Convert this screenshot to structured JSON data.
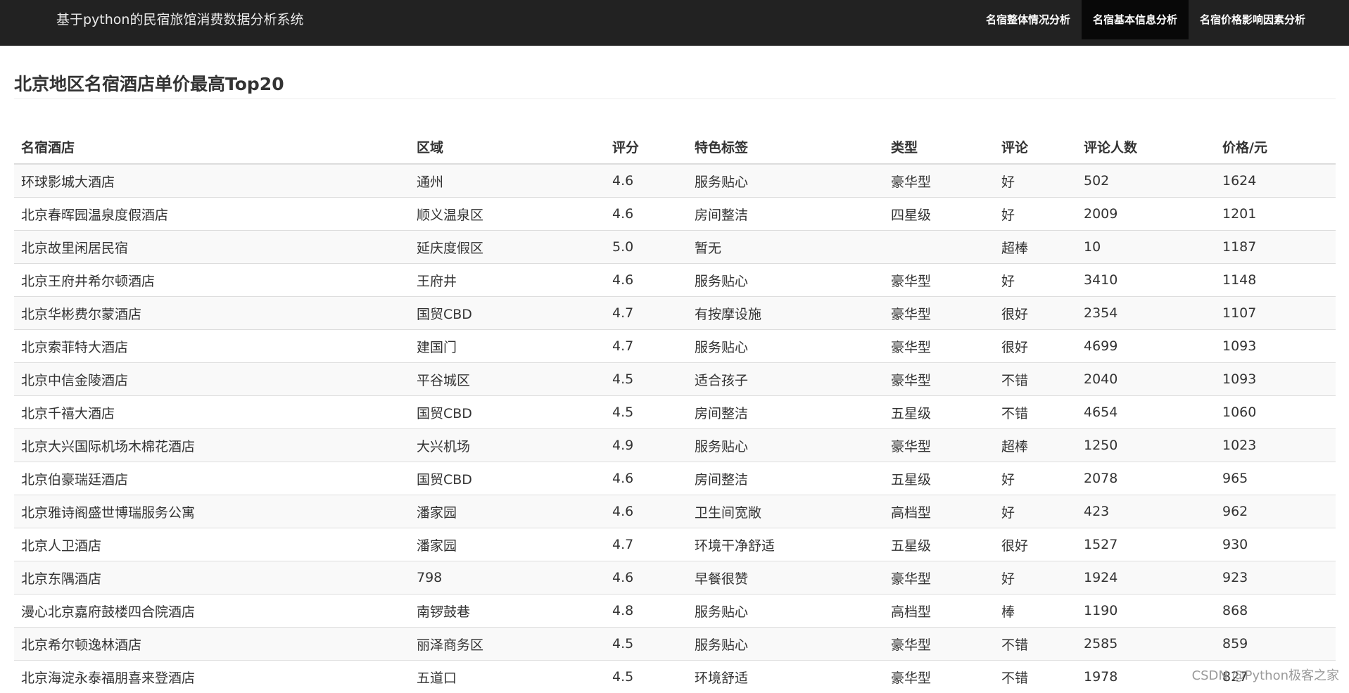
{
  "navbar": {
    "brand": "基于python的民宿旅馆消费数据分析系统",
    "items": [
      {
        "label": "名宿整体情况分析",
        "active": false
      },
      {
        "label": "名宿基本信息分析",
        "active": true
      },
      {
        "label": "名宿价格影响因素分析",
        "active": false
      }
    ]
  },
  "page": {
    "title": "北京地区名宿酒店单价最高Top20"
  },
  "table": {
    "headers": [
      "名宿酒店",
      "区域",
      "评分",
      "特色标签",
      "类型",
      "评论",
      "评论人数",
      "价格/元"
    ],
    "rows": [
      [
        "环球影城大酒店",
        "通州",
        "4.6",
        "服务贴心",
        "豪华型",
        "好",
        "502",
        "1624"
      ],
      [
        "北京春晖园温泉度假酒店",
        "顺义温泉区",
        "4.6",
        "房间整洁",
        "四星级",
        "好",
        "2009",
        "1201"
      ],
      [
        "北京故里闲居民宿",
        "延庆度假区",
        "5.0",
        "暂无",
        "",
        "超棒",
        "10",
        "1187"
      ],
      [
        "北京王府井希尔顿酒店",
        "王府井",
        "4.6",
        "服务贴心",
        "豪华型",
        "好",
        "3410",
        "1148"
      ],
      [
        "北京华彬费尔蒙酒店",
        "国贸CBD",
        "4.7",
        "有按摩设施",
        "豪华型",
        "很好",
        "2354",
        "1107"
      ],
      [
        "北京索菲特大酒店",
        "建国门",
        "4.7",
        "服务贴心",
        "豪华型",
        "很好",
        "4699",
        "1093"
      ],
      [
        "北京中信金陵酒店",
        "平谷城区",
        "4.5",
        "适合孩子",
        "豪华型",
        "不错",
        "2040",
        "1093"
      ],
      [
        "北京千禧大酒店",
        "国贸CBD",
        "4.5",
        "房间整洁",
        "五星级",
        "不错",
        "4654",
        "1060"
      ],
      [
        "北京大兴国际机场木棉花酒店",
        "大兴机场",
        "4.9",
        "服务贴心",
        "豪华型",
        "超棒",
        "1250",
        "1023"
      ],
      [
        "北京伯豪瑞廷酒店",
        "国贸CBD",
        "4.6",
        "房间整洁",
        "五星级",
        "好",
        "2078",
        "965"
      ],
      [
        "北京雅诗阁盛世博瑞服务公寓",
        "潘家园",
        "4.6",
        "卫生间宽敞",
        "高档型",
        "好",
        "423",
        "962"
      ],
      [
        "北京人卫酒店",
        "潘家园",
        "4.7",
        "环境干净舒适",
        "五星级",
        "很好",
        "1527",
        "930"
      ],
      [
        "北京东隅酒店",
        "798",
        "4.6",
        "早餐很赞",
        "豪华型",
        "好",
        "1924",
        "923"
      ],
      [
        "漫心北京嘉府鼓楼四合院酒店",
        "南锣鼓巷",
        "4.8",
        "服务贴心",
        "高档型",
        "棒",
        "1190",
        "868"
      ],
      [
        "北京希尔顿逸林酒店",
        "丽泽商务区",
        "4.5",
        "服务贴心",
        "豪华型",
        "不错",
        "2585",
        "859"
      ],
      [
        "北京海淀永泰福朋喜来登酒店",
        "五道口",
        "4.5",
        "环境舒适",
        "豪华型",
        "不错",
        "1978",
        "827"
      ]
    ]
  },
  "watermark": "CSDN @Python极客之家"
}
